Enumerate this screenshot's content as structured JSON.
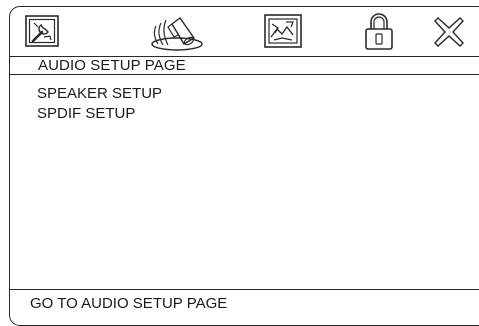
{
  "tabs": [
    {
      "id": "system",
      "icon": "system-setup-icon"
    },
    {
      "id": "audio",
      "icon": "speaker-icon",
      "selected": true
    },
    {
      "id": "video",
      "icon": "video-setup-icon"
    },
    {
      "id": "preference",
      "icon": "lock-icon"
    },
    {
      "id": "exit",
      "icon": "close-icon"
    }
  ],
  "page": {
    "title": "AUDIO SETUP PAGE"
  },
  "menu": {
    "items": [
      {
        "label": "SPEAKER SETUP"
      },
      {
        "label": "SPDIF SETUP"
      }
    ]
  },
  "status": {
    "text": "GO TO AUDIO SETUP PAGE"
  },
  "colors": {
    "line": "#2a2a2a",
    "text": "#1a1a1a",
    "background": "#ffffff"
  }
}
